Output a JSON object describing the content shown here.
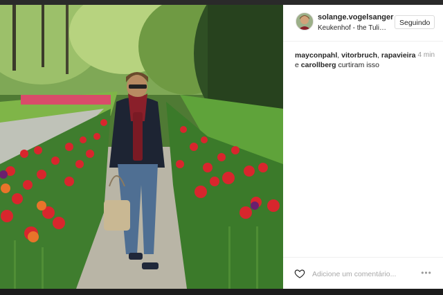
{
  "post": {
    "username": "solange.vogelsanger",
    "location": "Keukenhof - the Tulip...",
    "follow_label": "Seguindo",
    "likers": [
      "mayconpahl",
      "vitorbruch",
      "rapavieira",
      "carollberg"
    ],
    "likers_separator_1": ", ",
    "likers_separator_2": ", ",
    "likers_separator_3": ", ",
    "likers_and": "e",
    "likes_suffix": "curtiram isso",
    "time_ago": "4 min",
    "comment_placeholder": "Adicione um comentário...",
    "more_glyph": "•••"
  },
  "colors": {
    "panel_bg": "#ffffff",
    "text": "#262626",
    "muted": "#999999",
    "border": "#dbdbdb"
  },
  "icons": [
    "heart-icon",
    "more-options-icon",
    "avatar"
  ]
}
